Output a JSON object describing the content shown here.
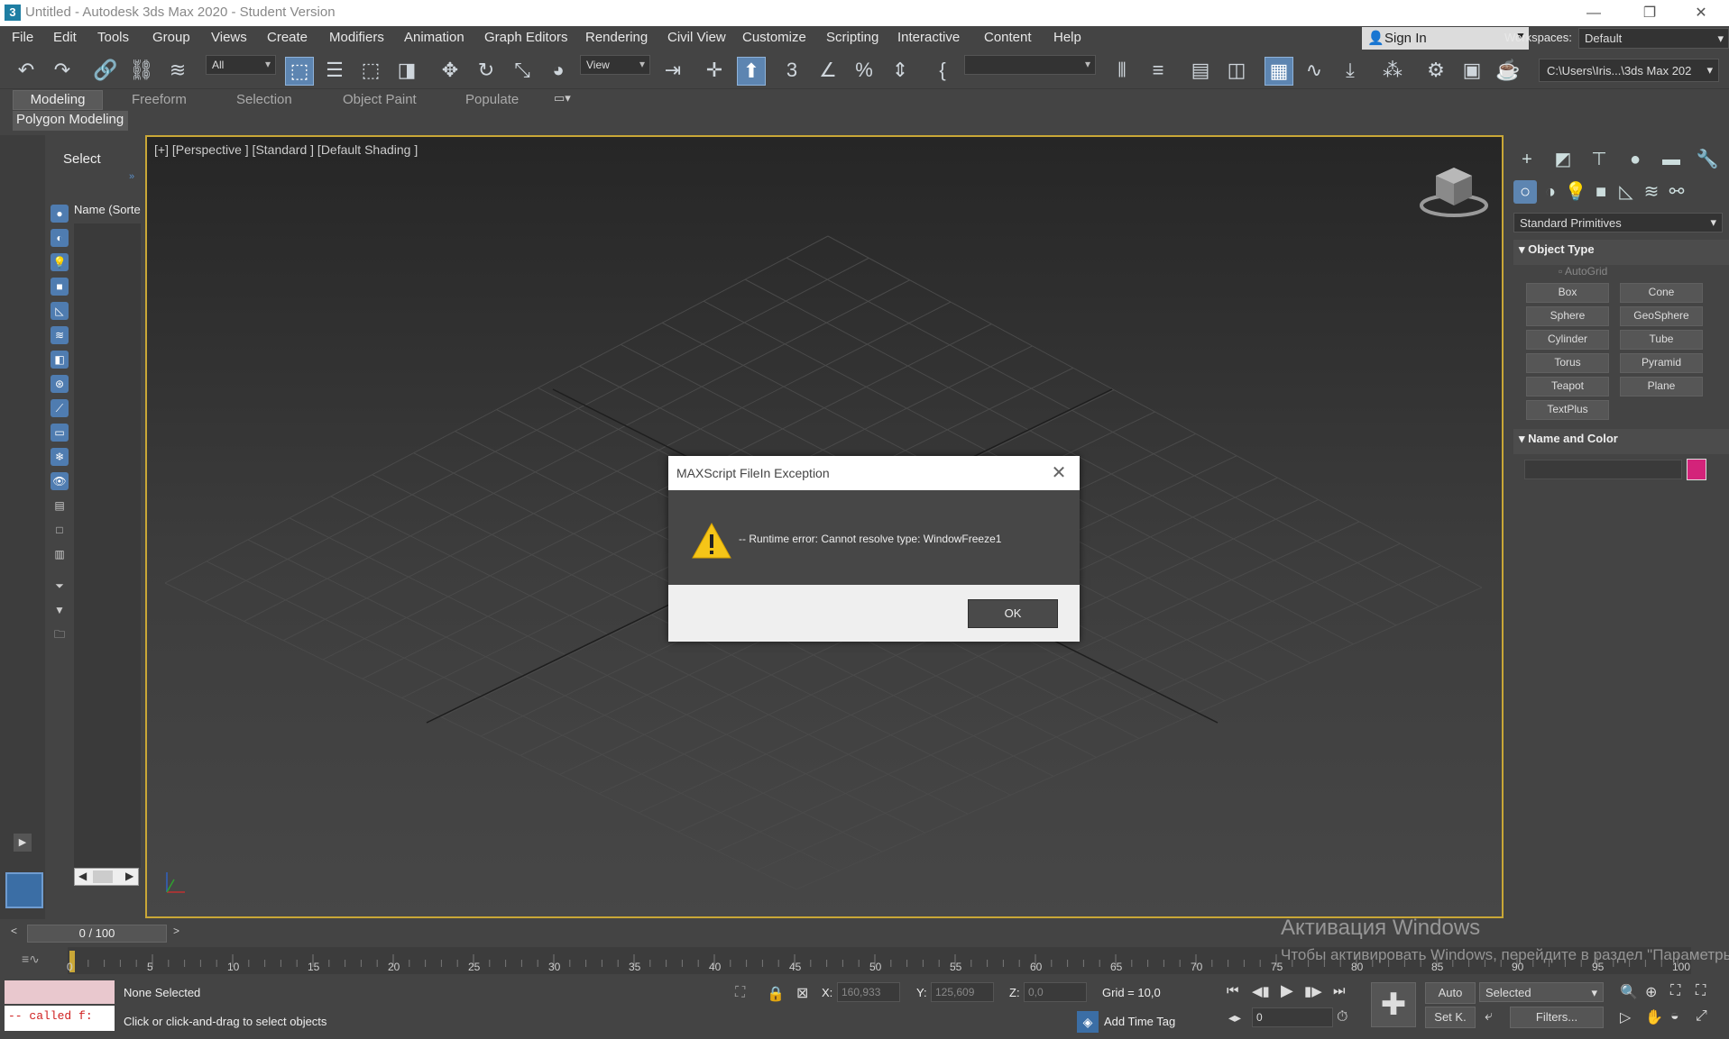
{
  "window": {
    "title": "Untitled - Autodesk 3ds Max 2020 - Student Version",
    "app_icon": "3",
    "controls": [
      "—",
      "❐",
      "✕"
    ]
  },
  "menubar": {
    "items": [
      "File",
      "Edit",
      "Tools",
      "Group",
      "Views",
      "Create",
      "Modifiers",
      "Animation",
      "Graph Editors",
      "Rendering",
      "Civil View",
      "Customize",
      "Scripting",
      "Interactive",
      "Content",
      "Help"
    ],
    "sign_in": "Sign In",
    "workspaces_label": "Workspaces:",
    "workspaces_value": "Default"
  },
  "toolbar": {
    "filter_value": "All",
    "refcoord_value": "View",
    "named_selection": "",
    "project_path": "C:\\Users\\Iris...\\3ds Max 202"
  },
  "ribbon": {
    "tabs": [
      "Modeling",
      "Freeform",
      "Selection",
      "Object Paint",
      "Populate"
    ],
    "sub_tab": "Polygon Modeling"
  },
  "scene_explorer": {
    "select_label": "Select",
    "name_column": "Name (Sorte"
  },
  "viewport": {
    "label": "[+] [Perspective ] [Standard ] [Default Shading ]"
  },
  "command_panel": {
    "category": "Standard Primitives",
    "object_type_title": "Object Type",
    "autogrid": "AutoGrid",
    "buttons": [
      "Box",
      "Cone",
      "Sphere",
      "GeoSphere",
      "Cylinder",
      "Tube",
      "Torus",
      "Pyramid",
      "Teapot",
      "Plane",
      "TextPlus"
    ],
    "name_color_title": "Name and Color",
    "object_color": "#d3237a"
  },
  "time": {
    "slider": "0 / 100",
    "ticks": [
      "0",
      "5",
      "10",
      "15",
      "20",
      "25",
      "30",
      "35",
      "40",
      "45",
      "50",
      "55",
      "60",
      "65",
      "70",
      "75",
      "80",
      "85",
      "90",
      "95",
      "100"
    ]
  },
  "status": {
    "selection": "None Selected",
    "prompt": "Click or click-and-drag to select objects",
    "maxscript_listener": "-- called f:",
    "x_label": "X:",
    "x_value": "160,933",
    "y_label": "Y:",
    "y_value": "125,609",
    "z_label": "Z:",
    "z_value": "0,0",
    "grid": "Grid = 10,0",
    "add_time_tag": "Add Time Tag",
    "auto_key": "Auto",
    "set_key": "Set K.",
    "key_filter": "Selected",
    "filters": "Filters...",
    "frame_value": "0"
  },
  "activation": {
    "title": "Активация Windows",
    "subtitle": "Чтобы активировать Windows, перейдите в раздел \"Параметры\"."
  },
  "dialog": {
    "title": "MAXScript FileIn Exception",
    "message": "-- Runtime error: Cannot resolve type: WindowFreeze1",
    "ok_label": "OK",
    "warning_icon": "warning-icon"
  }
}
